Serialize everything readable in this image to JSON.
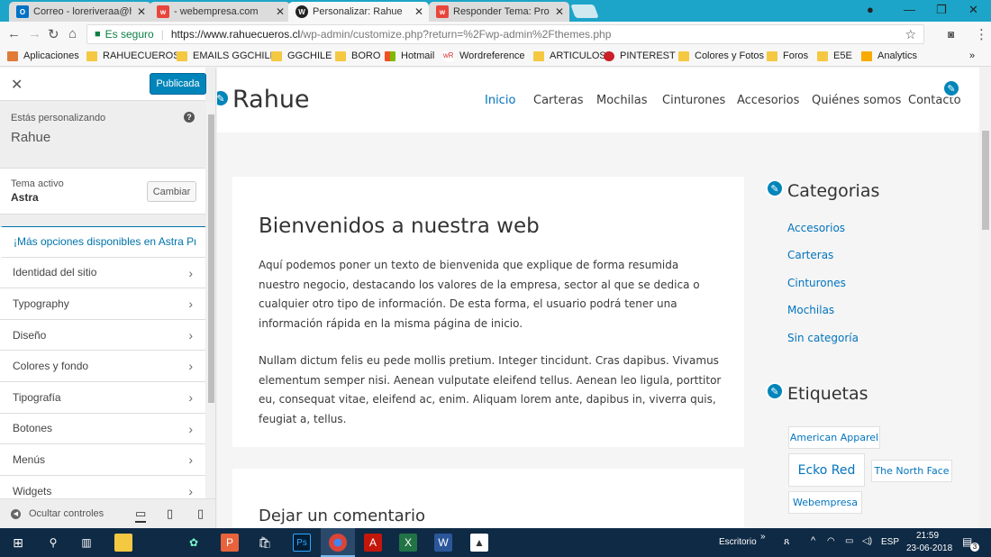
{
  "browser": {
    "tabs": [
      {
        "title": "Correo - loreriveraa@hot",
        "favicon": "outlook-icon"
      },
      {
        "title": "- webempresa.com",
        "favicon": "webempresa-icon"
      },
      {
        "title": "Personalizar: Rahue",
        "favicon": "wordpress-icon"
      },
      {
        "title": "Responder Tema: Probler",
        "favicon": "webempresa-icon"
      }
    ],
    "secure_label": "Es seguro",
    "url_domain": "https://www.rahuecueros.cl",
    "url_path": "/wp-admin/customize.php?return=%2Fwp-admin%2Fthemes.php",
    "bookmarks": [
      "Aplicaciones",
      "RAHUECUEROS",
      "EMAILS GGCHILE",
      "GGCHILE",
      "BORO",
      "Hotmail",
      "Wordreference",
      "ARTICULOS",
      "PINTEREST",
      "Colores y Fotos",
      "Foros",
      "E5E",
      "Analytics"
    ]
  },
  "customizer": {
    "publish_label": "Publicada",
    "customizing_label": "Estás personalizando",
    "site_name": "Rahue",
    "active_theme_label": "Tema activo",
    "active_theme_name": "Astra",
    "change_label": "Cambiar",
    "promo": "¡Más opciones disponibles en Astra Pro!",
    "sections": [
      "Identidad del sitio",
      "Typography",
      "Diseño",
      "Colores y fondo",
      "Tipografía",
      "Botones",
      "Menús",
      "Widgets"
    ],
    "hide_controls": "Ocultar controles"
  },
  "preview": {
    "site_title": "Rahue",
    "nav": [
      "Inicio",
      "Carteras",
      "Mochilas",
      "Cinturones",
      "Accesorios",
      "Quiénes somos",
      "Contacto"
    ],
    "article_title": "Bienvenidos a nuestra web",
    "paragraph1": "Aquí podemos poner un texto de bienvenida que explique de forma resumida nuestro negocio, destacando los valores de la empresa, sector al que se dedica o cualquier otro tipo de información. De esta forma, el usuario podrá tener una información rápida en la misma página de inicio.",
    "paragraph2": "Nullam dictum felis eu pede mollis pretium. Integer tincidunt. Cras dapibus. Vivamus elementum semper nisi. Aenean vulputate eleifend tellus. Aenean leo ligula, porttitor eu, consequat vitae, eleifend ac, enim. Aliquam lorem ante, dapibus in, viverra quis, feugiat a, tellus.",
    "comment_title": "Dejar un comentario",
    "categories_title": "Categorias",
    "categories": [
      "Accesorios",
      "Carteras",
      "Cinturones",
      "Mochilas",
      "Sin categoría"
    ],
    "tags_title": "Etiquetas",
    "tags": [
      "American Apparel",
      "Ecko Red",
      "The North Face",
      "Webempresa"
    ]
  },
  "taskbar": {
    "desktop_label": "Escritorio",
    "language": "ESP",
    "time": "21:59",
    "date": "23-06-2018",
    "notifications": "3"
  },
  "colors": {
    "accent": "#0274be",
    "publish": "#0085ba",
    "tabstrip": "#1ca5c8",
    "taskbar": "#0f2a45"
  }
}
